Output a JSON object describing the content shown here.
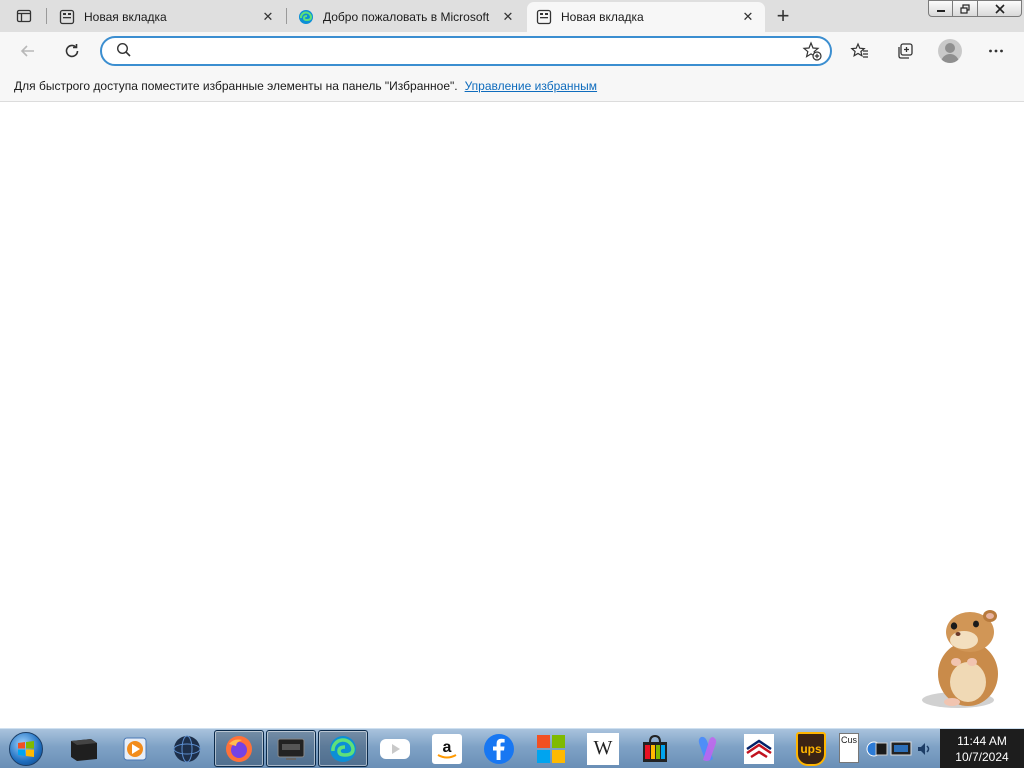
{
  "browser": {
    "tabs": [
      {
        "title": "Новая вкладка",
        "icon": "new-tab-page-icon",
        "active": false
      },
      {
        "title": "Добро пожаловать в Microsoft Edge",
        "icon": "edge-logo-icon",
        "active": false
      },
      {
        "title": "Новая вкладка",
        "icon": "new-tab-page-icon",
        "active": true
      }
    ],
    "close_glyph": "✕",
    "new_tab_glyph": "+",
    "address": {
      "value": "",
      "placeholder": ""
    },
    "favorites_bar": {
      "message": "Для быстрого доступа поместите избранные элементы на панель \"Избранное\".",
      "link": "Управление избранным"
    },
    "colors": {
      "accent": "#3b8ed0",
      "link": "#0f6cbd",
      "chrome": "#f7f7f7",
      "tabstrip": "#dfdfdf"
    }
  },
  "taskbar": {
    "apps": [
      {
        "name": "terminal",
        "icon": "terminal-icon"
      },
      {
        "name": "media-player",
        "icon": "media-player-icon"
      },
      {
        "name": "globe",
        "icon": "globe-icon"
      },
      {
        "name": "firefox",
        "icon": "firefox-icon"
      },
      {
        "name": "monitor",
        "icon": "monitor-icon"
      },
      {
        "name": "edge",
        "icon": "edge-icon"
      },
      {
        "name": "youtube",
        "icon": "youtube-icon"
      },
      {
        "name": "amazon",
        "icon": "amazon-icon"
      },
      {
        "name": "facebook",
        "icon": "facebook-icon"
      },
      {
        "name": "microsoft",
        "icon": "microsoft-icon"
      },
      {
        "name": "wikipedia",
        "icon": "wikipedia-icon",
        "label": "W"
      },
      {
        "name": "store",
        "icon": "store-icon"
      },
      {
        "name": "copilot",
        "icon": "copilot-icon"
      },
      {
        "name": "bank-of-america",
        "icon": "bank-of-america-icon"
      },
      {
        "name": "ups",
        "icon": "ups-icon",
        "label": "ups"
      }
    ],
    "tray": {
      "notification_text": "Cus",
      "show_hidden": "⏶"
    },
    "clock": {
      "time": "11:44 AM",
      "date": "10/7/2024"
    }
  }
}
